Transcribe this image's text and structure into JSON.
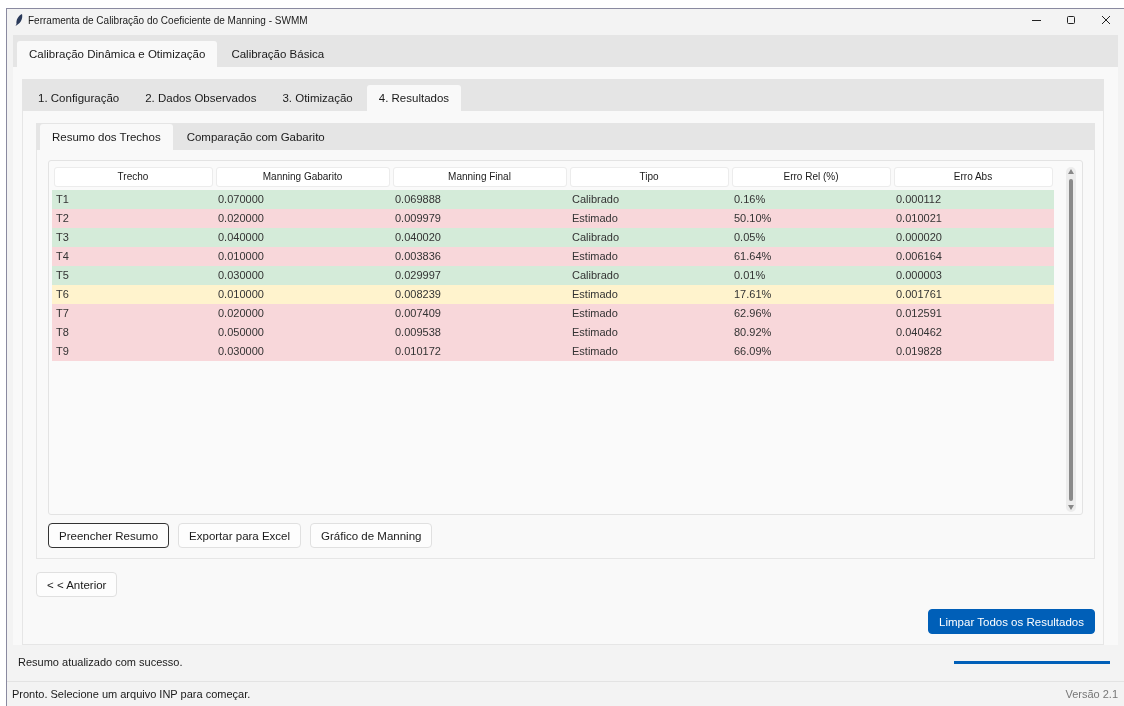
{
  "window": {
    "title": "Ferramenta de Calibração do Coeficiente de Manning - SWMM"
  },
  "main_tabs": [
    {
      "label": "Calibração Dinâmica e Otimização",
      "selected": true
    },
    {
      "label": "Calibração Básica",
      "selected": false
    }
  ],
  "step_tabs": [
    {
      "label": "1. Configuração",
      "selected": false
    },
    {
      "label": "2. Dados Observados",
      "selected": false
    },
    {
      "label": "3. Otimização",
      "selected": false
    },
    {
      "label": "4. Resultados",
      "selected": true
    }
  ],
  "result_tabs": [
    {
      "label": "Resumo dos Trechos",
      "selected": true
    },
    {
      "label": "Comparação com Gabarito",
      "selected": false
    }
  ],
  "table": {
    "columns": [
      "Trecho",
      "Manning Gabarito",
      "Manning Final",
      "Tipo",
      "Erro Rel (%)",
      "Erro Abs"
    ],
    "rows": [
      {
        "cells": [
          "T1",
          "0.070000",
          "0.069888",
          "Calibrado",
          "0.16%",
          "0.000112"
        ],
        "color": "#d4ebd9"
      },
      {
        "cells": [
          "T2",
          "0.020000",
          "0.009979",
          "Estimado",
          "50.10%",
          "0.010021"
        ],
        "color": "#f8d7da"
      },
      {
        "cells": [
          "T3",
          "0.040000",
          "0.040020",
          "Calibrado",
          "0.05%",
          "0.000020"
        ],
        "color": "#d4ebd9"
      },
      {
        "cells": [
          "T4",
          "0.010000",
          "0.003836",
          "Estimado",
          "61.64%",
          "0.006164"
        ],
        "color": "#f8d7da"
      },
      {
        "cells": [
          "T5",
          "0.030000",
          "0.029997",
          "Calibrado",
          "0.01%",
          "0.000003"
        ],
        "color": "#d4ebd9"
      },
      {
        "cells": [
          "T6",
          "0.010000",
          "0.008239",
          "Estimado",
          "17.61%",
          "0.001761"
        ],
        "color": "#fff3cd"
      },
      {
        "cells": [
          "T7",
          "0.020000",
          "0.007409",
          "Estimado",
          "62.96%",
          "0.012591"
        ],
        "color": "#f8d7da"
      },
      {
        "cells": [
          "T8",
          "0.050000",
          "0.009538",
          "Estimado",
          "80.92%",
          "0.040462"
        ],
        "color": "#f8d7da"
      },
      {
        "cells": [
          "T9",
          "0.030000",
          "0.010172",
          "Estimado",
          "66.09%",
          "0.019828"
        ],
        "color": "#f8d7da"
      }
    ]
  },
  "table_buttons": [
    {
      "label": "Preencher Resumo",
      "focused": true
    },
    {
      "label": "Exportar para Excel",
      "focused": false
    },
    {
      "label": "Gráfico de Manning",
      "focused": false
    }
  ],
  "back_button": "< < Anterior",
  "clear_button": "Limpar Todos os Resultados",
  "message": "Resumo atualizado com sucesso.",
  "progress": {
    "level": 1
  },
  "status_bar": {
    "text": "Pronto. Selecione um arquivo INP para começar.",
    "version": "Versão 2.1"
  }
}
